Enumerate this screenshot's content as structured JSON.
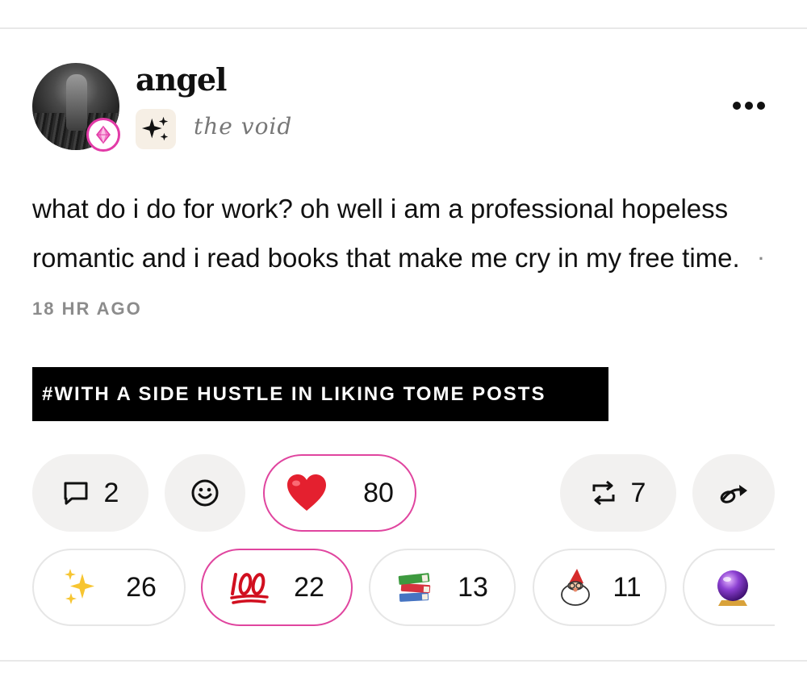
{
  "post": {
    "author": {
      "username": "angel",
      "avatar_icon": "user-avatar-photo",
      "badge_icon": "gem-badge-icon",
      "badge_color": "#e23aa7"
    },
    "community": {
      "name": "the void",
      "icon": "sparkles-icon"
    },
    "more_icon": "more-horizontal-icon",
    "body": "what do i do for work? oh well i am a professional hopeless romantic and i read books that make me cry in my free time.",
    "timestamp": "· 18 HR AGO",
    "tag": "#WITH A SIDE HUSTLE IN LIKING TOME POSTS"
  },
  "actions": {
    "comments": {
      "icon": "comment-icon",
      "count": "2"
    },
    "react": {
      "icon": "smiley-icon"
    },
    "heart": {
      "emoji": "❤️",
      "count": "80",
      "active": true
    },
    "reposts": {
      "icon": "repost-icon",
      "count": "7"
    },
    "share": {
      "icon": "share-icon"
    }
  },
  "reactions": [
    {
      "name": "sparkles",
      "emoji": "✨",
      "count": "26",
      "active": false
    },
    {
      "name": "hundred",
      "emoji": "💯",
      "count": "22",
      "active": true
    },
    {
      "name": "books",
      "emoji": "📚",
      "count": "13",
      "active": false
    },
    {
      "name": "gnome",
      "emoji": "🧙",
      "count": "11",
      "active": false
    },
    {
      "name": "crystal-ball",
      "emoji": "🔮",
      "count": "",
      "active": false
    }
  ],
  "colors": {
    "accent_pink": "#e0459f",
    "pill_bg": "#f2f1f0",
    "muted_text": "#8c8c8c",
    "tag_bg": "#000000"
  }
}
